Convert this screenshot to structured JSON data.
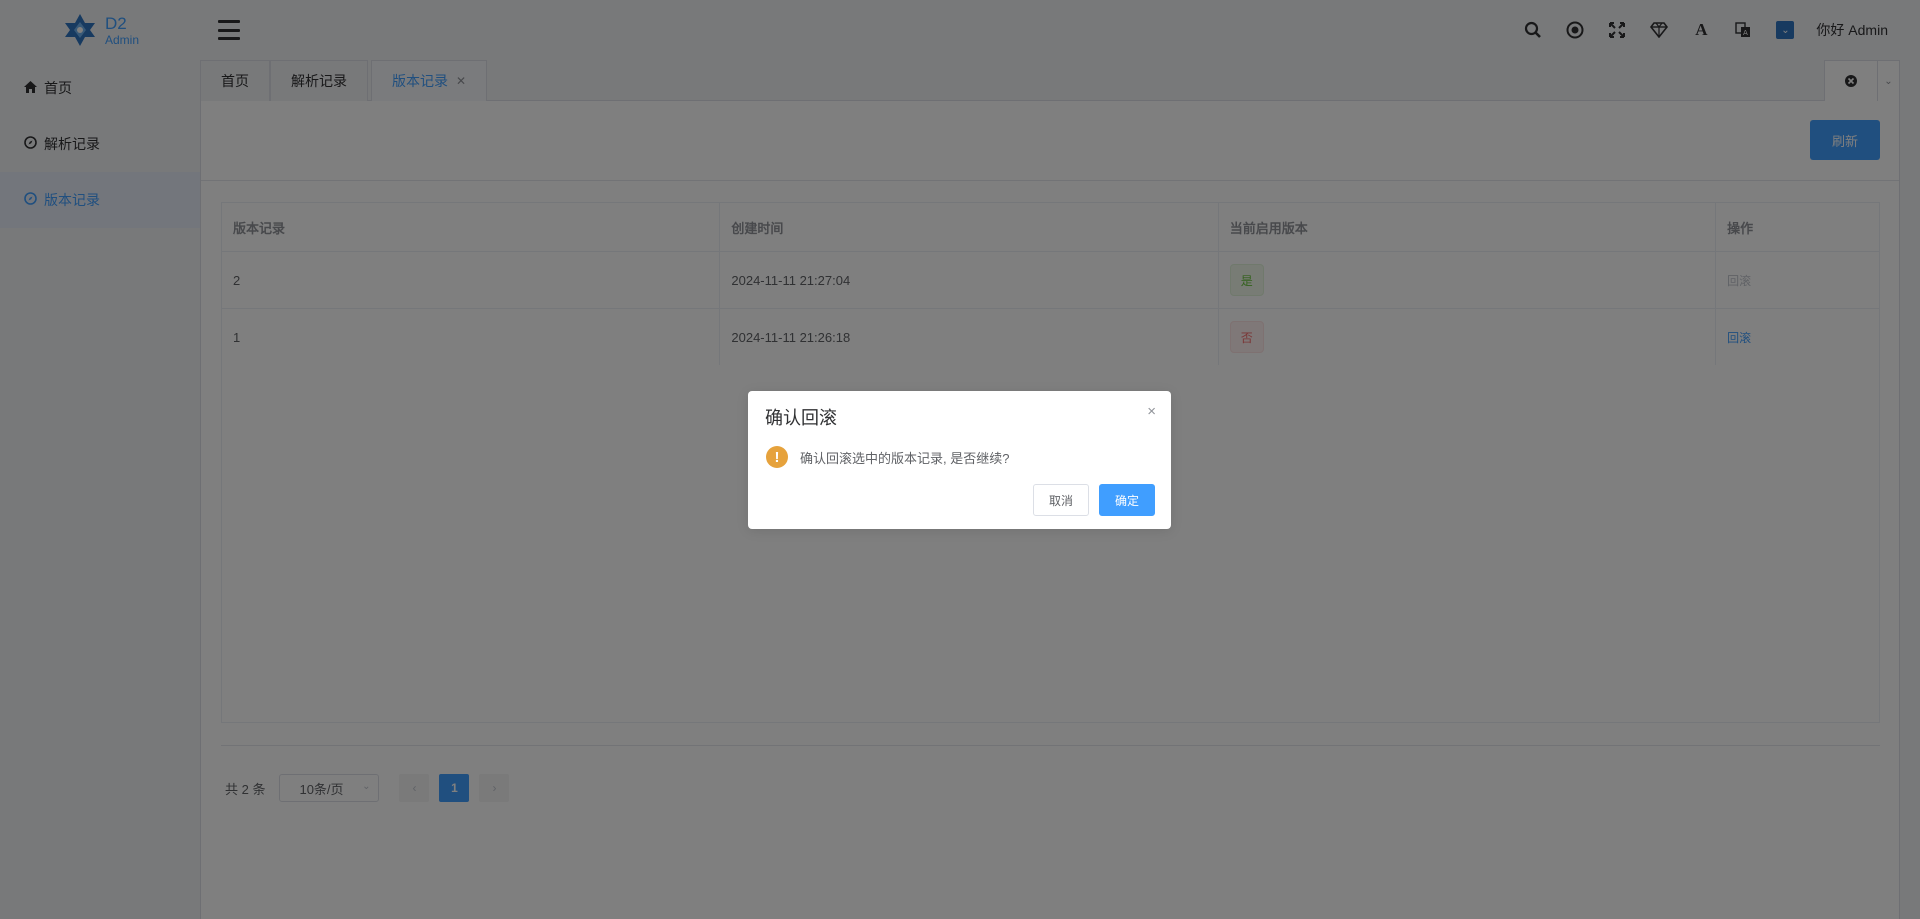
{
  "brand": {
    "title": "D2",
    "subtitle": "Admin"
  },
  "header": {
    "icons": [
      "search-icon",
      "github-icon",
      "fullscreen-icon",
      "theme-icon",
      "font-size-icon",
      "language-icon",
      "avatar-icon"
    ],
    "user_greeting": "你好 Admin"
  },
  "sidebar": {
    "items": [
      {
        "label": "首页",
        "icon": "home-icon"
      },
      {
        "label": "解析记录",
        "icon": "compass-icon"
      },
      {
        "label": "版本记录",
        "icon": "compass-icon",
        "active": true
      }
    ]
  },
  "tabs": [
    {
      "label": "首页"
    },
    {
      "label": "解析记录"
    },
    {
      "label": "版本记录",
      "active": true,
      "closable": true
    }
  ],
  "toolbar": {
    "refresh_label": "刷新"
  },
  "table": {
    "columns": [
      "版本记录",
      "创建时间",
      "当前启用版本",
      "操作"
    ],
    "rows": [
      {
        "version": "2",
        "created": "2024-11-11 21:27:04",
        "enabled": "是",
        "action": "回滚",
        "action_disabled": true
      },
      {
        "version": "1",
        "created": "2024-11-11 21:26:18",
        "enabled": "否",
        "action": "回滚",
        "action_disabled": false
      }
    ]
  },
  "pagination": {
    "total_label": "共 2 条",
    "page_size": "10条/页",
    "current_page": "1",
    "prev": "‹",
    "next": "›"
  },
  "dialog": {
    "title": "确认回滚",
    "message": "确认回滚选中的版本记录, 是否继续?",
    "cancel_label": "取消",
    "confirm_label": "确定",
    "close_glyph": "×",
    "icon_glyph": "!"
  },
  "colors": {
    "primary": "#409eff",
    "warning": "#e6a23c",
    "success": "#67c23a",
    "danger": "#f56c6c"
  }
}
